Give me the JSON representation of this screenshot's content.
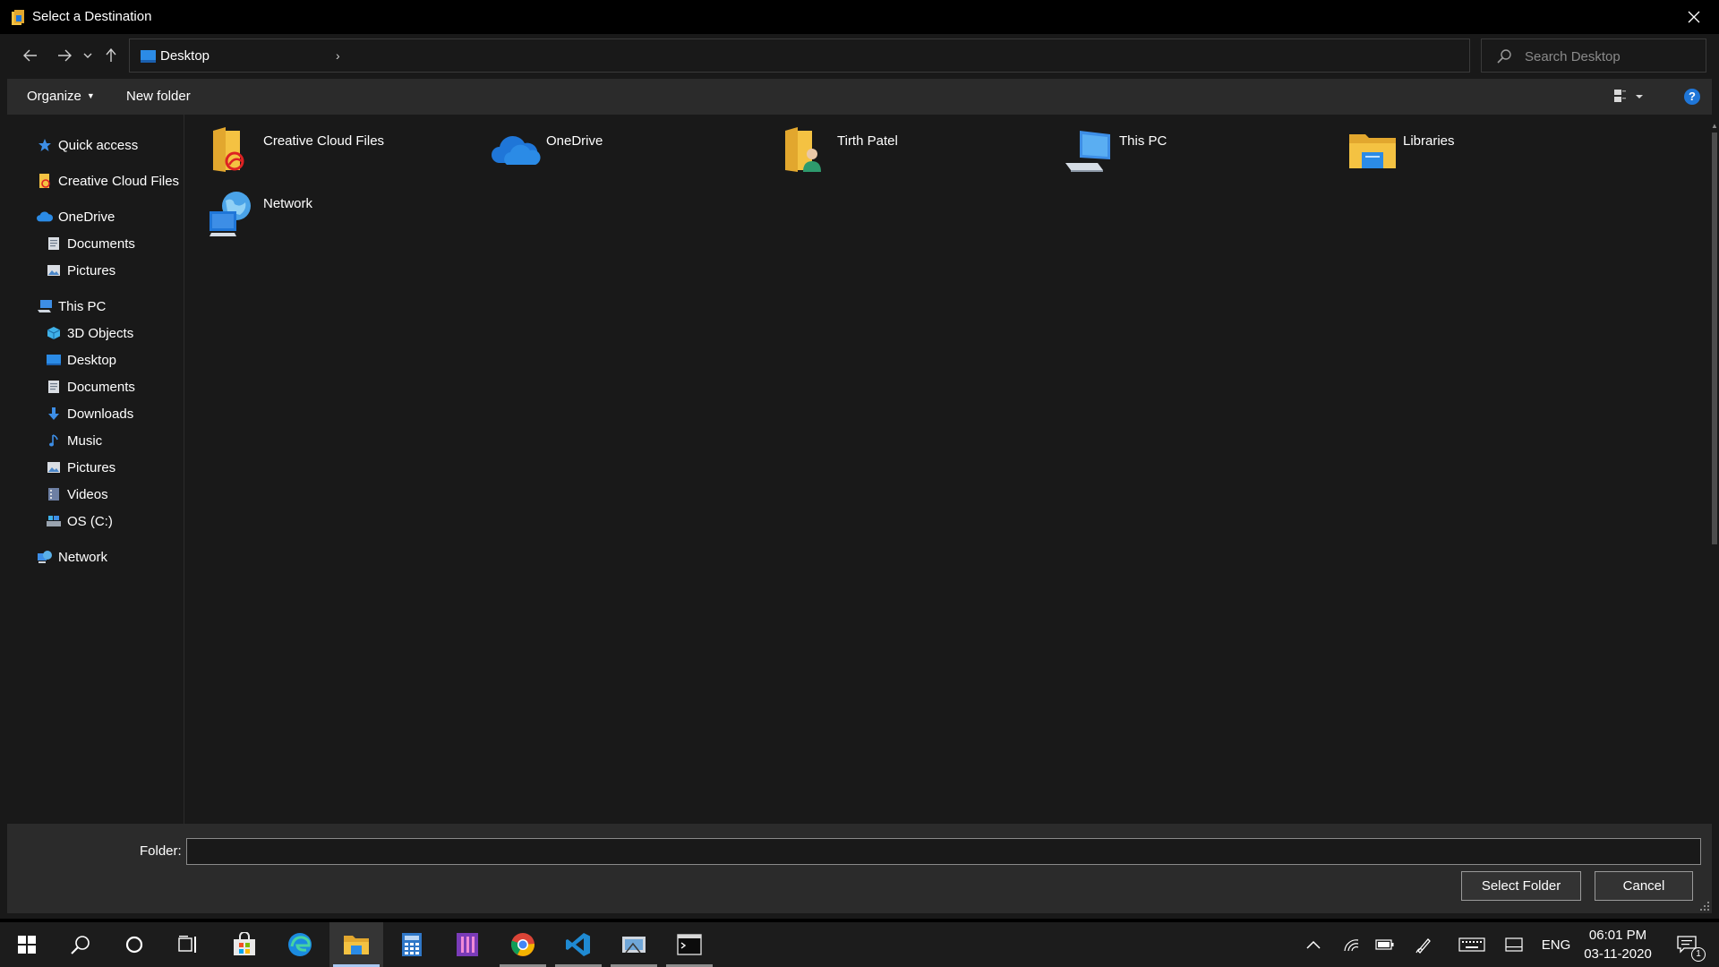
{
  "window": {
    "title": "Select a Destination"
  },
  "address_bar": {
    "location": "Desktop",
    "chevron": "›"
  },
  "search": {
    "placeholder": "Search Desktop"
  },
  "toolbar": {
    "organize_label": "Organize",
    "new_folder_label": "New folder",
    "help_label": "?"
  },
  "nav_pane": {
    "items": [
      {
        "label": "Quick access",
        "icon": "star-icon"
      },
      {
        "label": "Creative Cloud Files",
        "icon": "creative-cloud-folder-icon"
      },
      {
        "label": "OneDrive",
        "icon": "onedrive-cloud-icon"
      },
      {
        "label": "Documents",
        "icon": "documents-icon"
      },
      {
        "label": "Pictures",
        "icon": "pictures-icon"
      },
      {
        "label": "This PC",
        "icon": "computer-icon"
      },
      {
        "label": "3D Objects",
        "icon": "cube-icon"
      },
      {
        "label": "Desktop",
        "icon": "desktop-icon"
      },
      {
        "label": "Documents",
        "icon": "documents-icon"
      },
      {
        "label": "Downloads",
        "icon": "download-arrow-icon"
      },
      {
        "label": "Music",
        "icon": "music-note-icon"
      },
      {
        "label": "Pictures",
        "icon": "pictures-icon"
      },
      {
        "label": "Videos",
        "icon": "videos-icon"
      },
      {
        "label": "OS (C:)",
        "icon": "drive-icon"
      },
      {
        "label": "Network",
        "icon": "network-icon"
      }
    ]
  },
  "content": {
    "items": [
      {
        "label": "Creative Cloud Files",
        "icon": "creative-cloud-folder-icon"
      },
      {
        "label": "OneDrive",
        "icon": "onedrive-cloud-icon"
      },
      {
        "label": "Tirth Patel",
        "icon": "user-folder-icon"
      },
      {
        "label": "This PC",
        "icon": "computer-icon"
      },
      {
        "label": "Libraries",
        "icon": "libraries-folder-icon"
      },
      {
        "label": "Network",
        "icon": "network-globe-icon"
      }
    ]
  },
  "footer": {
    "folder_label": "Folder:",
    "folder_value": "",
    "select_folder_label": "Select Folder",
    "cancel_label": "Cancel"
  },
  "taskbar": {
    "language": "ENG",
    "time": "06:01 PM",
    "date": "03-11-2020",
    "notification_count": "1"
  },
  "colors": {
    "accent_blue": "#1f76d8",
    "folder_yellow": "#f4c242",
    "window_bg": "#191919",
    "toolbar_bg": "#2b2b2b"
  }
}
